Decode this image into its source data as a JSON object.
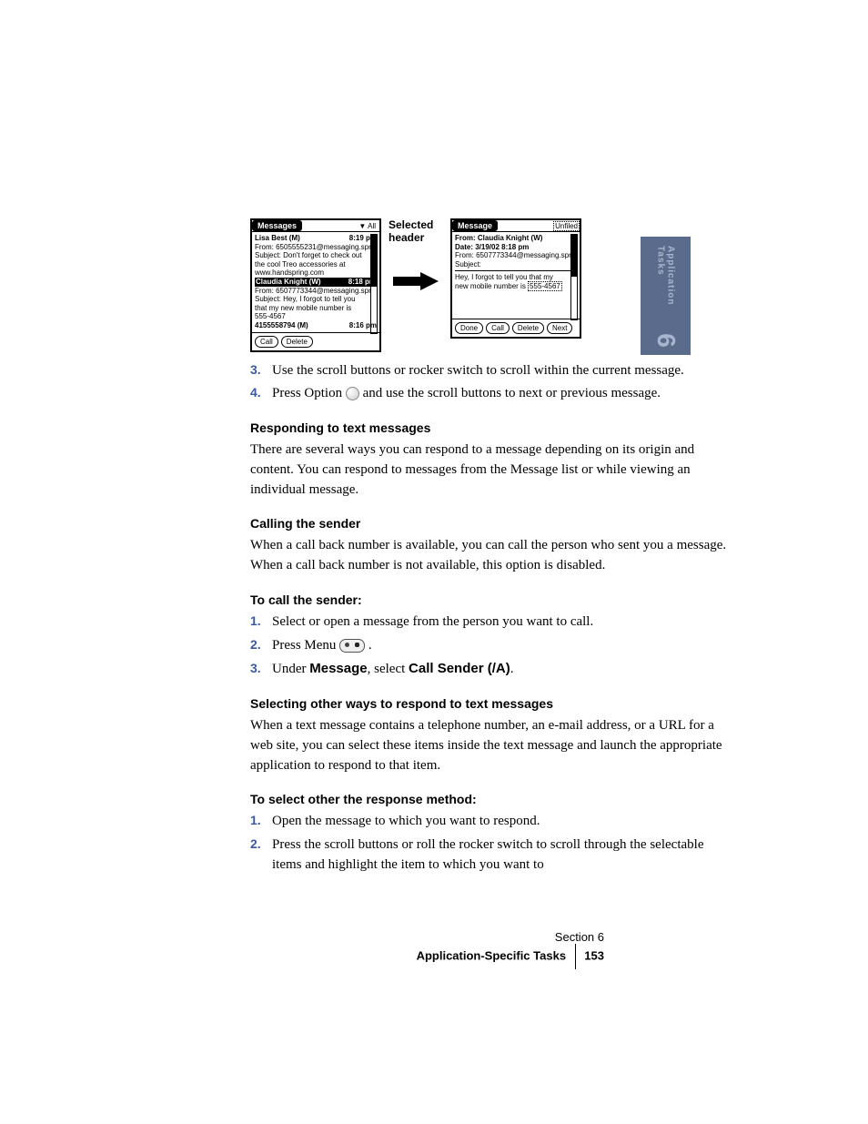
{
  "sideTab": {
    "label": "Application Tasks",
    "chapter": "6"
  },
  "screens": {
    "left": {
      "title": "Messages",
      "dropdown": "▼ All",
      "items": [
        {
          "name": "Lisa Best (M)",
          "time": "8:19 pm",
          "from": "From: 6505555231@messaging.spr",
          "subject": "Subject:  Don't forget to check out",
          "l1": "the cool Treo accessories at",
          "l2": "www.handspring.com"
        },
        {
          "name": "Claudia Knight (W)",
          "time": "8:18 pm",
          "from": "From: 6507773344@messaging.spr",
          "subject": "Subject:  Hey, I forgot to tell you",
          "l1": "that my new mobile number is",
          "l2": "555-4567"
        },
        {
          "name": "4155558794 (M)",
          "time": "8:16 pm"
        }
      ],
      "buttons": [
        "Call",
        "Delete"
      ]
    },
    "callout": "Selected header",
    "right": {
      "title": "Message",
      "dropdown": "Unfiled",
      "from": "From:  Claudia Knight (W)",
      "date": "Date:  3/19/02 8:18 pm",
      "from2": "From: 6507773344@messaging.spr",
      "subject": "Subject:",
      "body1": "Hey, I forgot to tell you that my",
      "body2a": "new mobile number is ",
      "body2b": "555-4567",
      "buttons": [
        "Done",
        "Call",
        "Delete",
        "Next"
      ]
    }
  },
  "steps_a": [
    {
      "n": "3.",
      "t": "Use the scroll buttons or rocker switch to scroll within the current message."
    },
    {
      "n": "4.",
      "pre": "Press Option ",
      "post": " and use the scroll buttons to next or previous message."
    }
  ],
  "h_responding": "Responding to text messages",
  "p_responding": "There are several ways you can respond to a message depending on its origin and content. You can respond to messages from the Message list or while viewing an individual message.",
  "h_calling": "Calling the sender",
  "p_calling": "When a call back number is available, you can call the person who sent you a message. When a call back number is not available, this option is disabled.",
  "h_to_call": "To call the sender:",
  "steps_b": [
    {
      "n": "1.",
      "t": "Select or open a message from the person you want to call."
    },
    {
      "n": "2.",
      "pre": "Press Menu ",
      "post": " ."
    },
    {
      "n": "3.",
      "pre": "Under ",
      "b1": "Message",
      "mid": ", select ",
      "b2": "Call Sender (/A)",
      "post": "."
    }
  ],
  "h_selecting": "Selecting other ways to respond to text messages",
  "p_selecting": "When a text message contains a telephone number, an e-mail address, or a URL for a web site, you can select these items inside the text message and launch the appropriate application to respond to that item.",
  "h_to_select": "To select other the response method:",
  "steps_c": [
    {
      "n": "1.",
      "t": "Open the message to which you want to respond."
    },
    {
      "n": "2.",
      "t": "Press the scroll buttons or roll the rocker switch to scroll through the selectable items and highlight the item to which you want to"
    }
  ],
  "footer": {
    "section": "Section 6",
    "title": "Application-Specific Tasks",
    "page": "153"
  }
}
